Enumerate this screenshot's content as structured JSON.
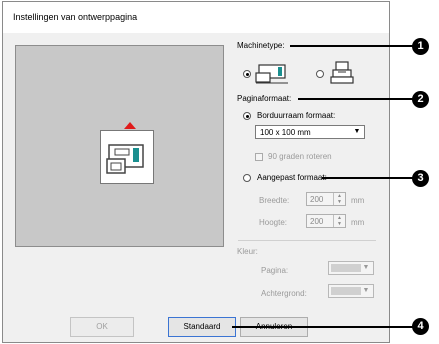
{
  "dialog": {
    "title": "Instellingen van ontwerppagina"
  },
  "machine_type": {
    "label": "Machinetype:",
    "option1_icon": "embroidery-machine-icon",
    "option2_icon": "embroidery-multi-needle-icon"
  },
  "page_format": {
    "label": "Paginaformaat:",
    "hoop_label": "Borduurraam formaat:",
    "hoop_value": "100 x 100 mm",
    "rotate_label": "90 graden roteren",
    "custom_label": "Aangepast formaat:",
    "width_label": "Breedte:",
    "width_value": "200",
    "width_unit": "mm",
    "height_label": "Hoogte:",
    "height_value": "200",
    "height_unit": "mm"
  },
  "color": {
    "label": "Kleur:",
    "page_label": "Pagina:",
    "background_label": "Achtergrond:"
  },
  "buttons": {
    "ok": "OK",
    "default": "Standaard",
    "cancel": "Annuleren"
  },
  "callouts": [
    "1",
    "2",
    "3",
    "4"
  ],
  "colors": {
    "badge": "#000000",
    "accent": "#e01b1b",
    "teal": "#1a8f8f"
  }
}
